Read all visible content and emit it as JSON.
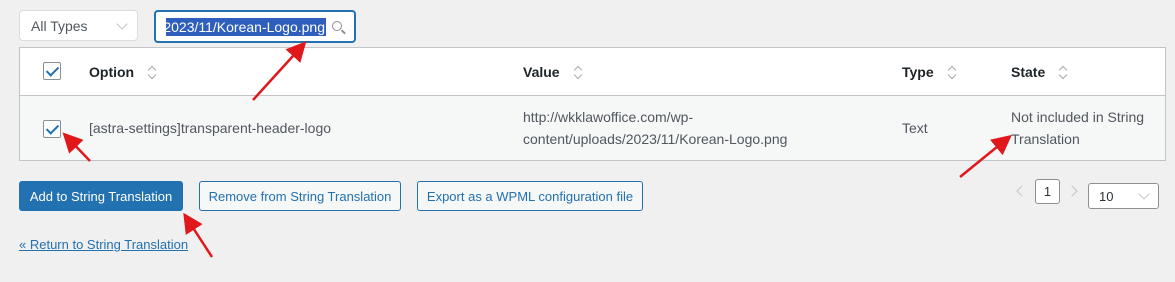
{
  "filter": {
    "type_selected": "All Types"
  },
  "search": {
    "value": "2023/11/Korean-Logo.png"
  },
  "table": {
    "columns": [
      "Option",
      "Value",
      "Type",
      "State"
    ],
    "rows": [
      {
        "option": "[astra-settings]transparent-header-logo",
        "value_line1": "http://wkklawoffice.com/wp-",
        "value_line2": "content/uploads/2023/11/Korean-Logo.png",
        "type": "Text",
        "state_line1": "Not included in String",
        "state_line2": "Translation"
      }
    ]
  },
  "actions": {
    "add": "Add to String Translation",
    "remove": "Remove from String Translation",
    "export": "Export as a WPML configuration file"
  },
  "pagination": {
    "current_page": "1",
    "per_page": "10"
  },
  "footer": {
    "return_link": "« Return to String Translation"
  },
  "colors": {
    "accent": "#2271b1",
    "annotation": "#e0171b"
  }
}
